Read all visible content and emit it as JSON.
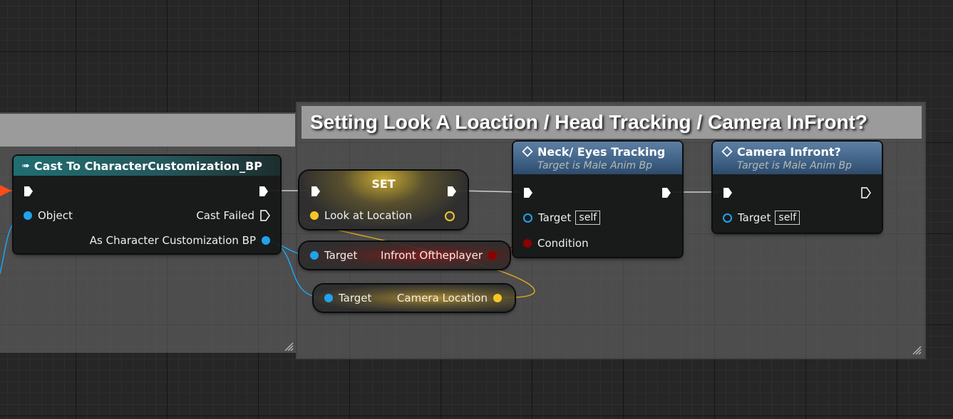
{
  "comments": [
    {
      "title": ""
    },
    {
      "title": "Setting Look A Loaction / Head Tracking / Camera InFront?"
    }
  ],
  "cast_node": {
    "title": "Cast To CharacterCustomization_BP",
    "object_pin": "Object",
    "cast_failed_pin": "Cast Failed",
    "output_pin": "As Character Customization BP"
  },
  "set_node": {
    "title": "SET",
    "input_pin": "Look at Location"
  },
  "infront_getter": {
    "target_pin": "Target",
    "output_pin": "Infront Oftheplayer"
  },
  "camera_getter": {
    "target_pin": "Target",
    "output_pin": "Camera Location"
  },
  "neck_node": {
    "title": "Neck/ Eyes Tracking",
    "subtitle": "Target is Male Anim Bp",
    "target_pin": "Target",
    "target_value": "self",
    "condition_pin": "Condition"
  },
  "camera_node": {
    "title": "Camera Infront?",
    "subtitle": "Target is Male Anim Bp",
    "target_pin": "Target",
    "target_value": "self"
  },
  "colors": {
    "exec": "#ffffff",
    "object": "#1ea4ee",
    "vector": "#f7c624",
    "boolean": "#8e0000",
    "comment_title": "#9b9b9b"
  },
  "icons": [
    "function-icon",
    "cast-icon",
    "exec-pin-icon",
    "resize-grip-icon"
  ]
}
